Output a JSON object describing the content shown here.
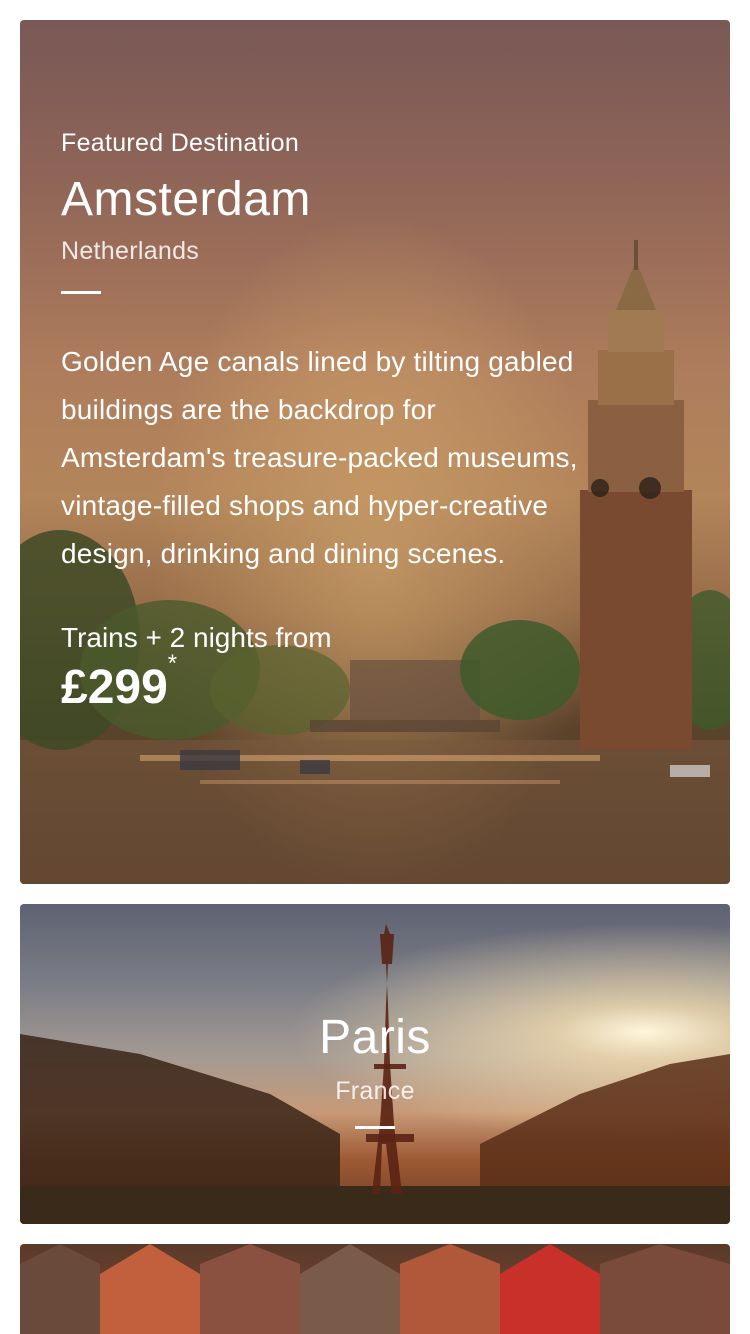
{
  "featured": {
    "eyebrow": "Featured Destination",
    "city": "Amsterdam",
    "country": "Netherlands",
    "description": "Golden Age canals lined by tilting gabled buildings are the backdrop for Amsterdam's treasure-packed museums, vintage-filled shops and hyper-creative design, drinking and dining scenes.",
    "offer_label": "Trains + 2 nights from",
    "price": "£299",
    "price_note": "*"
  },
  "cards": [
    {
      "city": "Paris",
      "country": "France"
    }
  ]
}
